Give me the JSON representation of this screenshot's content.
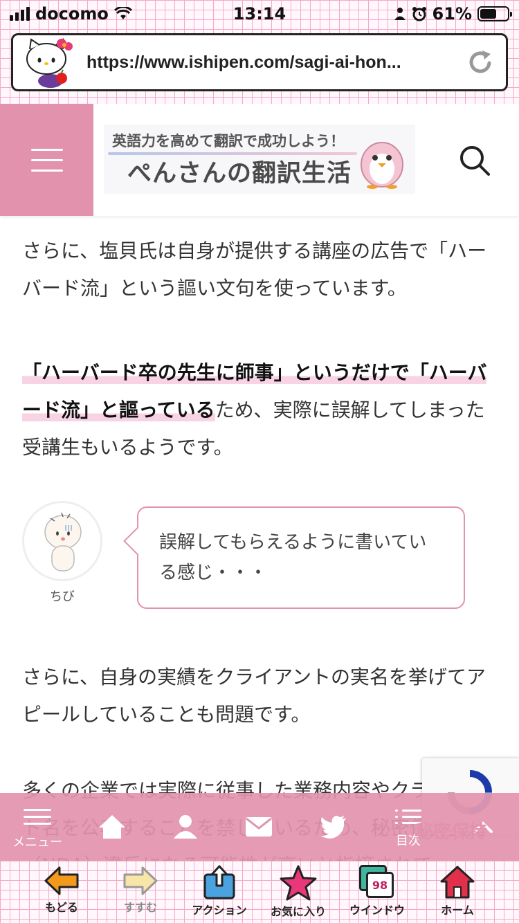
{
  "status_bar": {
    "carrier": "docomo",
    "time": "13:14",
    "battery": "61%",
    "battery_level": 0.61
  },
  "browser": {
    "url": "https://www.ishipen.com/sagi-ai-hon..."
  },
  "site_header": {
    "logo_tagline": "英語力を高めて翻訳で成功しよう！",
    "logo_title": "ぺんさんの翻訳生活"
  },
  "article": {
    "p1": "さらに、塩貝氏は自身が提供する講座の広告で「ハーバード流」という謳い文句を使っています。",
    "p2_highlight": "「ハーバード卒の先生に師事」というだけで「ハーバード流」と謳っている",
    "p2_rest": "ため、実際に誤解してしまった受講生もいるようです。",
    "speech": {
      "name": "ちび",
      "text": "誤解してもらえるように書いている感じ・・・"
    },
    "p3": "さらに、自身の実績をクライアントの実名を挙げてアピールしていることも問題です。",
    "p4": "多くの企業では実際に従事した業務内容やクライアント名を公表することを禁じているため、秘密保持契約（NDA）違反になる可能性が高いと指摘されて"
  },
  "site_footer": {
    "menu_label": "メニュー",
    "toc_label": "目次",
    "secret_label": "秘密保持"
  },
  "toolbar": {
    "back": "もどる",
    "forward": "すすむ",
    "action": "アクション",
    "favorites": "お気に入り",
    "window": "ウインドウ",
    "window_count": "98",
    "home": "ホーム"
  },
  "colors": {
    "accent_pink": "#e292ac",
    "grid_pink": "#f3a9c7"
  }
}
